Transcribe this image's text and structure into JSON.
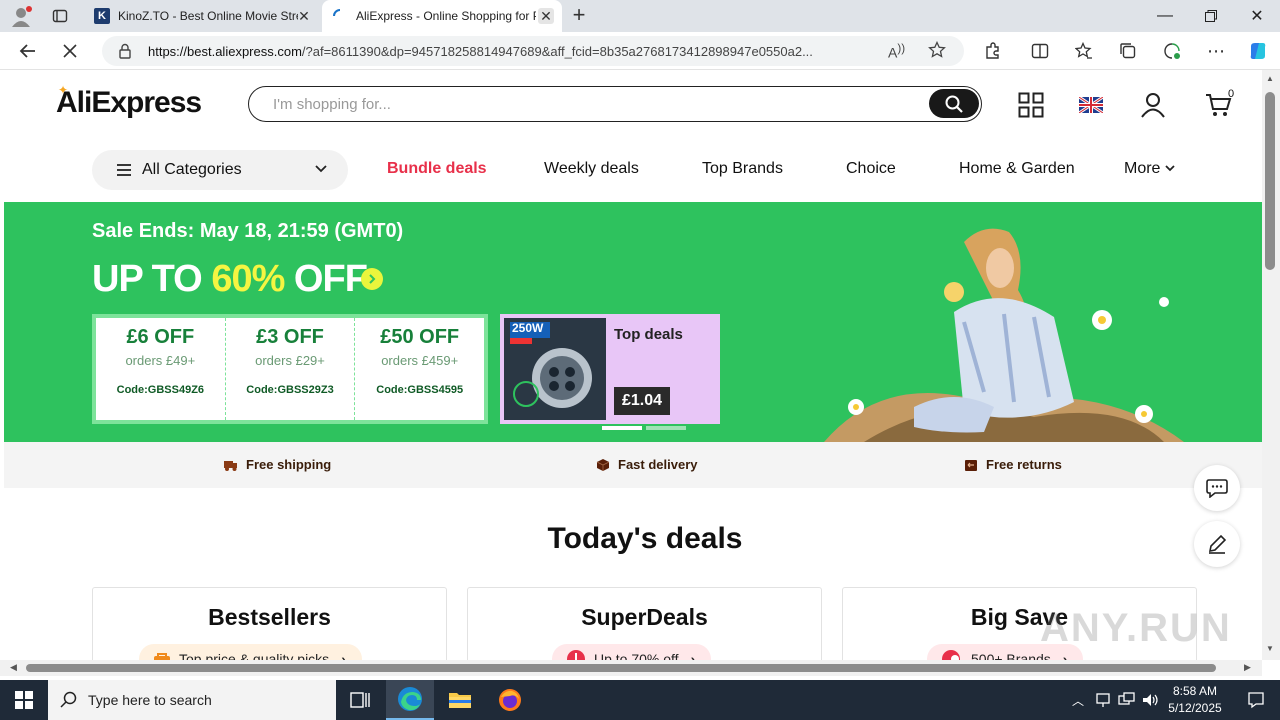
{
  "browser": {
    "tabs": [
      {
        "title": "KinoZ.TO - Best Online Movie Streaming",
        "favicon": "K"
      },
      {
        "title": "AliExpress - Online Shopping for Popular",
        "favicon": "spinner"
      }
    ],
    "url_domain": "https://best.aliexpress.com",
    "url_rest": "/?af=8611390&dp=945718258814947689&aff_fcid=8b35a2768173412898947e0550a2..."
  },
  "header": {
    "logo": "AliExpress",
    "search_placeholder": "I'm shopping for...",
    "cart_count": "0"
  },
  "nav": {
    "all_categories": "All Categories",
    "links": [
      "Bundle deals",
      "Weekly deals",
      "Top Brands",
      "Choice",
      "Home & Garden",
      "More"
    ]
  },
  "banner": {
    "sale_ends": "Sale Ends: May 18, 21:59 (GMT0)",
    "headline_prefix": "UP TO ",
    "headline_pct": "60%",
    "headline_suffix": " OFF",
    "coupons": [
      {
        "amount": "£6 OFF",
        "min": "orders £49+",
        "code": "Code:GBSS49Z6"
      },
      {
        "amount": "£3 OFF",
        "min": "orders £29+",
        "code": "Code:GBSS29Z3"
      },
      {
        "amount": "£50 OFF",
        "min": "orders £459+",
        "code": "Code:GBSS4595"
      }
    ],
    "top_deals_title": "Top deals",
    "top_deals_price": "£1.04",
    "product_badge": "250W",
    "colors": {
      "banner_bg": "#2ec25e",
      "accent_yellow": "#f5f542",
      "hot_red": "#e8304a"
    }
  },
  "services": [
    "Free shipping",
    "Fast delivery",
    "Free returns"
  ],
  "deals": {
    "title": "Today's deals",
    "cards": [
      {
        "title": "Bestsellers",
        "pill": "Top price & quality picks",
        "pill_color": "#fff1e0"
      },
      {
        "title": "SuperDeals",
        "pill": "Up to 70% off",
        "pill_color": "#ffe8ea"
      },
      {
        "title": "Big Save",
        "pill": "500+ Brands",
        "pill_color": "#ffe8ea"
      }
    ]
  },
  "watermark": "ANY.RUN",
  "taskbar": {
    "search_placeholder": "Type here to search",
    "time": "8:58 AM",
    "date": "5/12/2025"
  }
}
